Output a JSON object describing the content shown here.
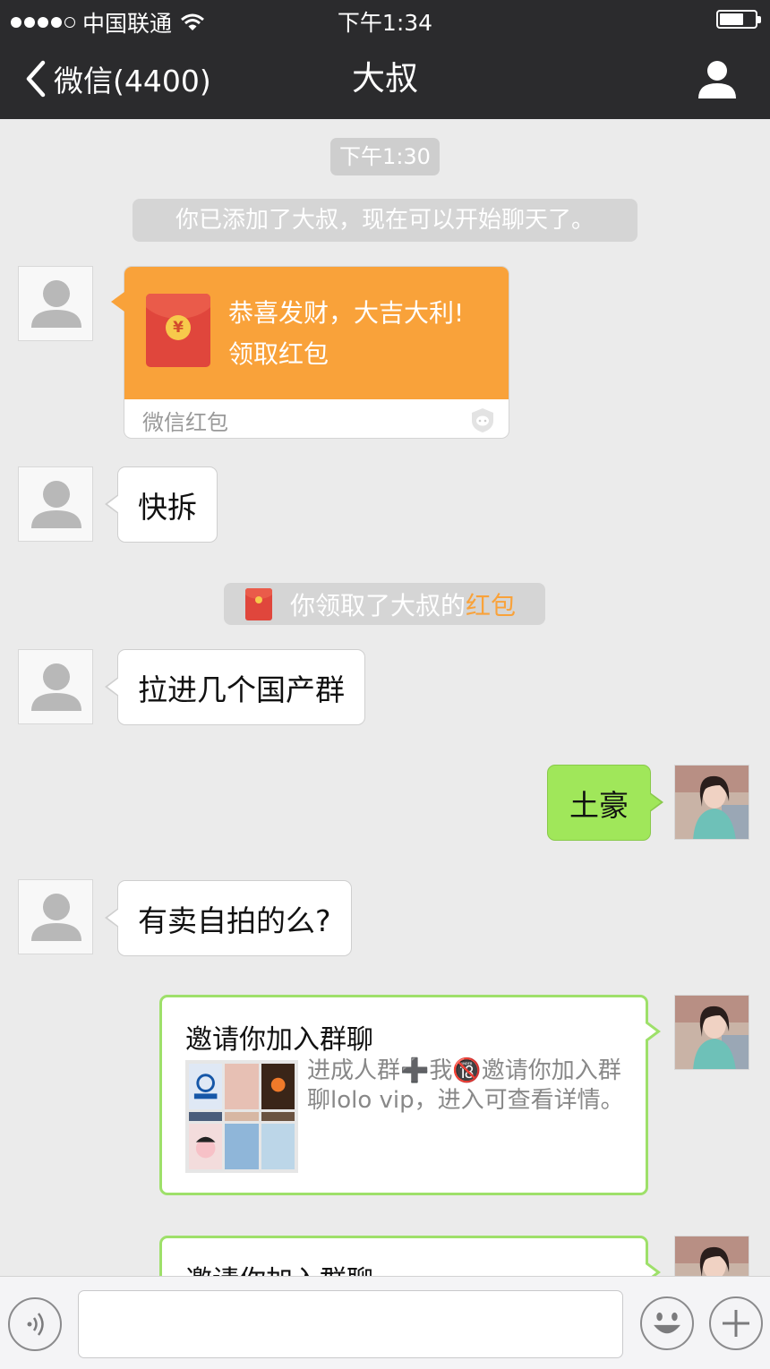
{
  "status_bar": {
    "carrier": "中国联通",
    "time": "下午1:34"
  },
  "nav": {
    "back_label": "微信(4400)",
    "title": "大叔"
  },
  "chat": {
    "timestamp": "下午1:30",
    "system_message": "你已添加了大叔，现在可以开始聊天了。",
    "red_packet": {
      "greeting": "恭喜发财，大吉大利!",
      "action": "领取红包",
      "footer": "微信红包"
    },
    "msg_1": "快拆",
    "notice": {
      "text": "你领取了大叔的",
      "highlight": "红包"
    },
    "msg_2": "拉进几个国产群",
    "msg_3_me": "土豪",
    "msg_4": "有卖自拍的么?",
    "invite_1": {
      "title": "邀请你加入群聊",
      "desc": "进成人群➕我🔞邀请你加入群聊lolo  vip，进入可查看详情。"
    },
    "invite_2": {
      "title": "邀请你加入群聊"
    }
  },
  "colors": {
    "nav_bg": "#2b2b2d",
    "chat_bg": "#ebebeb",
    "my_bubble": "#a0e75a",
    "red_packet": "#f9a23a"
  },
  "icons": [
    "back-chevron-icon",
    "wifi-icon",
    "battery-icon",
    "profile-icon",
    "voice-icon",
    "emoji-icon",
    "plus-icon"
  ]
}
